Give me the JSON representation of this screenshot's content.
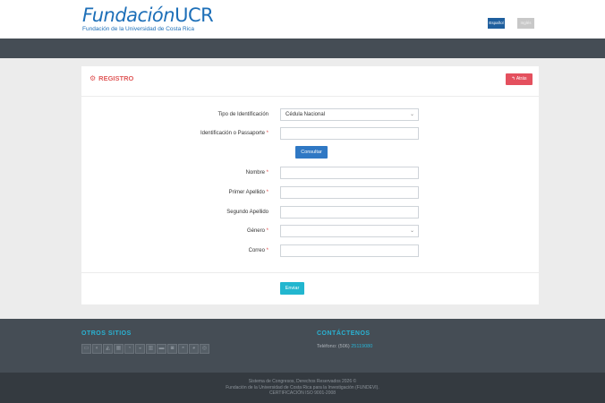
{
  "header": {
    "logo_main": "Fundación",
    "logo_ucr": "UCR",
    "logo_sub": "Fundación de la Universidad de Costa Rica",
    "lang_es": "Español",
    "lang_en": "Inglés"
  },
  "card": {
    "title": "REGISTRO",
    "back_label": "Atrás"
  },
  "form": {
    "tipo_label": "Tipo de Identificación",
    "tipo_value": "Cédula Nacional",
    "ident_label": "Identificación o Passaporte",
    "consultar_label": "Consultar",
    "nombre_label": "Nombre",
    "primer_label": "Primer Apellido",
    "segundo_label": "Segundo Apellido",
    "genero_label": "Género",
    "correo_label": "Correo",
    "enviar_label": "Enviar",
    "required_mark": "*"
  },
  "footer": {
    "otros_title": "OTROS SITIOS",
    "contact_title": "CONTÁCTENOS",
    "phone_label": "Teléfono: (506)",
    "phone_number": "25119080",
    "copyright_1": "Sistema de Congresos, Derechos Reservados 2026 ©",
    "copyright_2": "Fundación de la Universidad de Costa Rica para la Investigación (FUNDEVI).",
    "copyright_3": "CERTIFICACIÓN ISO 9001-2008"
  },
  "colors": {
    "brand_blue": "#1d6fb8",
    "danger": "#e4505e",
    "primary": "#2f78c4",
    "info": "#22b6cf",
    "dark": "#454d55"
  }
}
